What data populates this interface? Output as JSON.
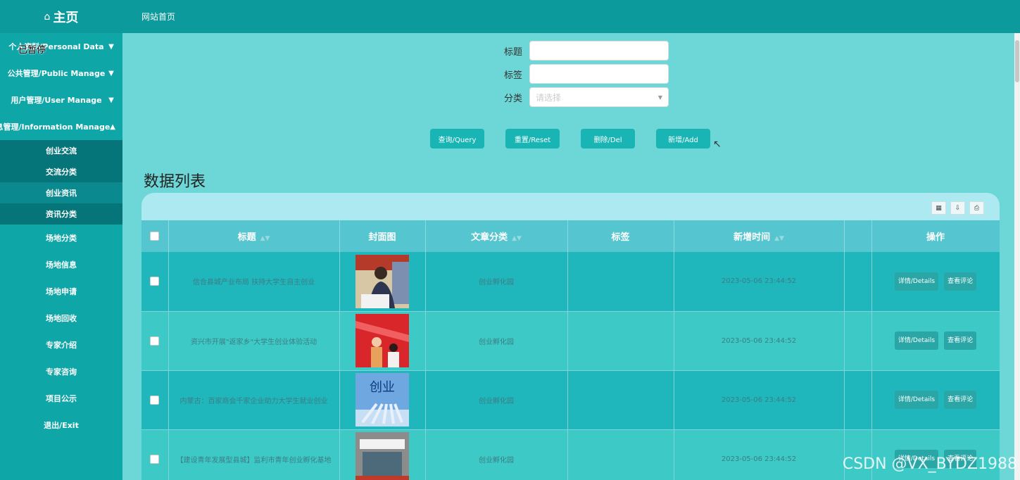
{
  "sidebar": {
    "brand": "主页",
    "paused": "已暂停",
    "menus": [
      {
        "label": "个人资料/Personal Data",
        "expanded": false
      },
      {
        "label": "公共管理/Public Manage",
        "expanded": false
      },
      {
        "label": "用户管理/User Manage",
        "expanded": false
      },
      {
        "label": "信息管理/Information Manage",
        "expanded": true
      }
    ],
    "sub_items": [
      "创业交流",
      "交流分类",
      "创业资讯",
      "资讯分类"
    ],
    "items": [
      "场地分类",
      "场地信息",
      "场地申请",
      "场地回收",
      "专家介绍",
      "专家咨询",
      "项目公示",
      "退出/Exit"
    ]
  },
  "topbar": {
    "title": "网站首页"
  },
  "search": {
    "title_label": "标题",
    "tag_label": "标签",
    "category_label": "分类",
    "category_placeholder": "请选择"
  },
  "buttons": {
    "query": "查询/Query",
    "reset": "重置/Reset",
    "delete": "删除/Del",
    "add": "新增/Add"
  },
  "list": {
    "title": "数据列表",
    "headers": [
      "标题",
      "封面图",
      "文章分类",
      "标签",
      "新增时间",
      "操作"
    ],
    "rows": [
      {
        "title": "信合县城产业布局 扶持大学生自主创业",
        "category": "创业孵化园",
        "tag": "",
        "time": "2023-05-06 23:44:52"
      },
      {
        "title": "资兴市开展\"返家乡\"大学生创业体验活动",
        "category": "创业孵化园",
        "tag": "",
        "time": "2023-05-06 23:44:52"
      },
      {
        "title": "内蒙古：百家商会千家企业助力大学生就业创业",
        "category": "创业孵化园",
        "tag": "",
        "time": "2023-05-06 23:44:52"
      },
      {
        "title": "【建设青年发展型县城】监利市青年创业孵化基地",
        "category": "创业孵化园",
        "tag": "",
        "time": "2023-05-06 23:44:52"
      }
    ],
    "detail_label": "详情/Details",
    "comment_label": "查看评论"
  },
  "watermark": "CSDN @VX_BYDZ1988"
}
